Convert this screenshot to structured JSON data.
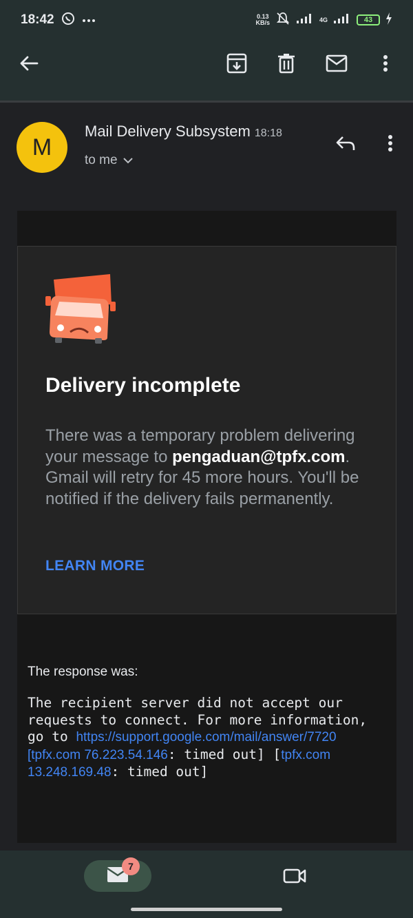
{
  "status_bar": {
    "time": "18:42",
    "net_speed_value": "0.13",
    "net_speed_unit": "KB/s",
    "network": "4G",
    "battery": "43"
  },
  "toolbar": {
    "icons": [
      "back-arrow-icon",
      "archive-icon",
      "delete-icon",
      "mark-unread-icon",
      "more-vert-icon"
    ]
  },
  "email": {
    "avatar_letter": "M",
    "sender": "Mail Delivery Subsystem",
    "time": "18:18",
    "recipient": "to me"
  },
  "bounce": {
    "title": "Delivery incomplete",
    "body_before": "There was a temporary problem delivering your message to ",
    "address": "pengaduan@tpfx.com",
    "body_after": ". Gmail will retry for 45 more hours. You'll be notified if the delivery fails permanently.",
    "learn_more": "LEARN MORE"
  },
  "response": {
    "label": "The response was:",
    "text_1": "The recipient server did not accept our requests to connect. For more information, go to ",
    "link_1": "https://support.google.com/mail/answer/7720",
    "link_2": "[tpfx.com 76.223.54.146",
    "text_2": ": timed out] [",
    "link_3": "tpfx.com 13.248.169.48",
    "text_3": ": timed out]"
  },
  "bottom_nav": {
    "mail_badge": "7"
  },
  "colors": {
    "accent_link": "#4285f4",
    "avatar_bg": "#f4c20d",
    "truck": "#f4623a",
    "badge": "#f28b82"
  }
}
